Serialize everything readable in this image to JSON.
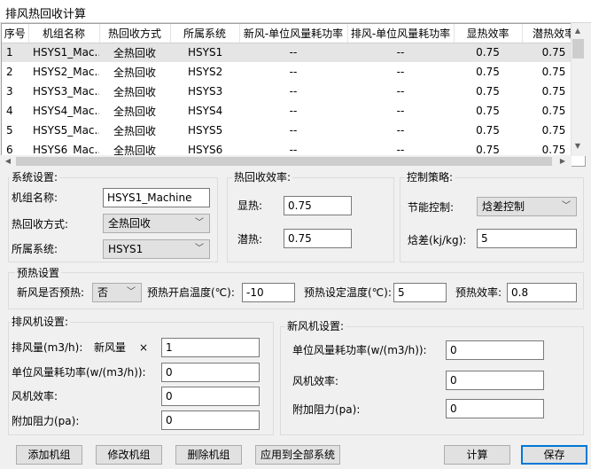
{
  "window": {
    "title": "排风热回收计算"
  },
  "grid": {
    "columns": [
      "序号",
      "机组名称",
      "热回收方式",
      "所属系统",
      "新风-单位风量耗功率",
      "排风-单位风量耗功率",
      "显热效率",
      "潜热效率"
    ],
    "rows": [
      [
        "1",
        "HSYS1_Mac...",
        "全热回收",
        "HSYS1",
        "--",
        "--",
        "0.75",
        "0.75"
      ],
      [
        "2",
        "HSYS2_Mac...",
        "全热回收",
        "HSYS2",
        "--",
        "--",
        "0.75",
        "0.75"
      ],
      [
        "3",
        "HSYS3_Mac...",
        "全热回收",
        "HSYS3",
        "--",
        "--",
        "0.75",
        "0.75"
      ],
      [
        "4",
        "HSYS4_Mac...",
        "全热回收",
        "HSYS4",
        "--",
        "--",
        "0.75",
        "0.75"
      ],
      [
        "5",
        "HSYS5_Mac...",
        "全热回收",
        "HSYS5",
        "--",
        "--",
        "0.75",
        "0.75"
      ],
      [
        "6",
        "HSYS6_Mac...",
        "全热回收",
        "HSYS6",
        "--",
        "--",
        "0.75",
        "0.75"
      ]
    ],
    "selected_row": 0
  },
  "system": {
    "legend": "系统设置:",
    "unit_name_label": "机组名称:",
    "unit_name_value": "HSYS1_Machine",
    "recovery_label": "热回收方式:",
    "recovery_value": "全热回收",
    "system_label": "所属系统:",
    "system_value": "HSYS1"
  },
  "efficiency": {
    "legend": "热回收效率:",
    "sensible_label": "显热:",
    "sensible_value": "0.75",
    "latent_label": "潜热:",
    "latent_value": "0.75"
  },
  "control": {
    "legend": "控制策略:",
    "energy_label": "节能控制:",
    "energy_value": "焓差控制",
    "enthalpy_label": "焓差(kj/kg):",
    "enthalpy_value": "5"
  },
  "preheat": {
    "legend": "预热设置",
    "enable_label": "新风是否预热:",
    "enable_value": "否",
    "start_label": "预热开启温度(℃):",
    "start_value": "-10",
    "set_label": "预热设定温度(℃):",
    "set_value": "5",
    "eff_label": "预热效率:",
    "eff_value": "0.8"
  },
  "exhaust_fan": {
    "legend": "排风机设置:",
    "volume_label": "排风量(m3/h):",
    "volume_text": "新风量",
    "times_sign": "×",
    "volume_value": "1",
    "power_label": "单位风量耗功率(w/(m3/h)):",
    "power_value": "0",
    "eff_label": "风机效率:",
    "eff_value": "0",
    "resist_label": "附加阻力(pa):",
    "resist_value": "0"
  },
  "fresh_fan": {
    "legend": "新风机设置:",
    "power_label": "单位风量耗功率(w/(m3/h)):",
    "power_value": "0",
    "eff_label": "风机效率:",
    "eff_value": "0",
    "resist_label": "附加阻力(pa):",
    "resist_value": "0"
  },
  "buttons": {
    "add": "添加机组",
    "modify": "修改机组",
    "delete": "删除机组",
    "apply_all": "应用到全部系统",
    "calculate": "计算",
    "save": "保存"
  },
  "icons": {
    "combo_arrow": "chevron-down-icon",
    "scroll_up": "arrow-up-icon",
    "scroll_down": "arrow-down-icon",
    "scroll_left": "arrow-left-icon",
    "scroll_right": "arrow-right-icon"
  },
  "colors": {
    "window_bg": "#f0f0f0",
    "selected_row": "#e5e5e5",
    "primary_border": "#0078d7"
  }
}
